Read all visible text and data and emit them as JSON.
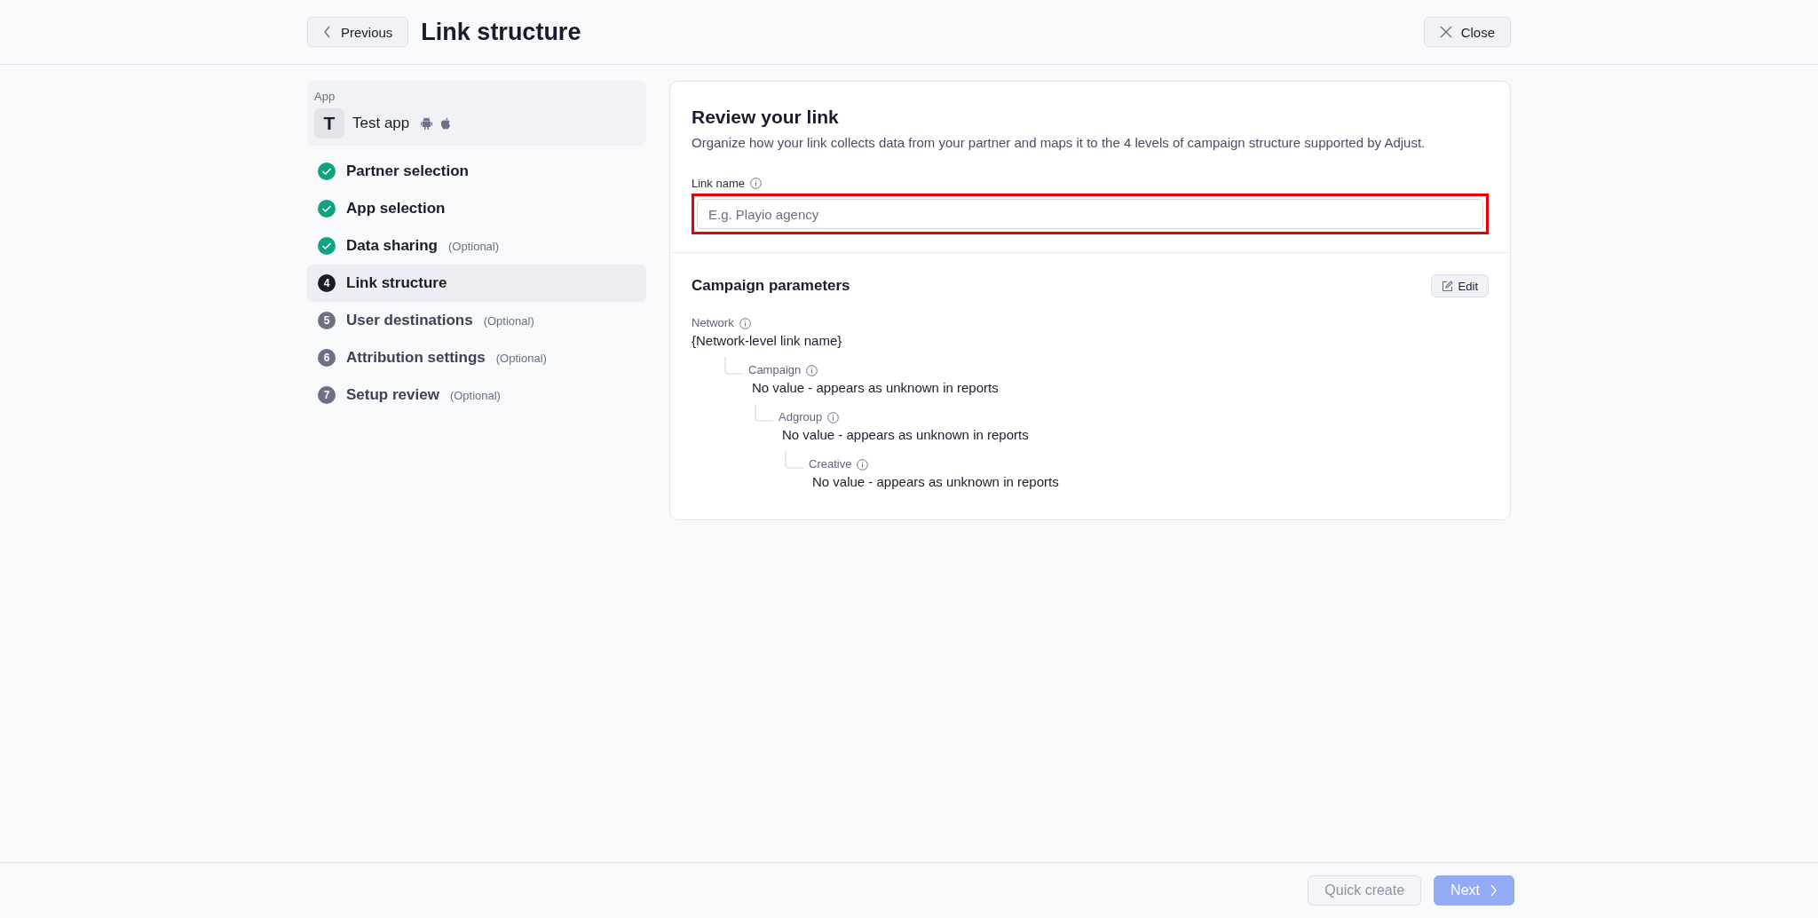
{
  "header": {
    "back_button": "Previous",
    "title": "Link structure",
    "close_button": "Close"
  },
  "sidebar": {
    "app": {
      "label": "App",
      "avatar": "T",
      "name": "Test app"
    },
    "steps": [
      {
        "label": "Partner selection",
        "kind": "done",
        "selected": false
      },
      {
        "label": "App selection",
        "kind": "done",
        "selected": false
      },
      {
        "label": "Data sharing",
        "note": "(Optional)",
        "kind": "done",
        "selected": false
      },
      {
        "label": "Link structure",
        "number": "4",
        "kind": "current",
        "selected": true
      },
      {
        "label": "User destinations",
        "note": "(Optional)",
        "number": "5",
        "kind": "pending",
        "selected": false
      },
      {
        "label": "Attribution settings",
        "note": "(Optional)",
        "number": "6",
        "kind": "pending",
        "selected": false
      },
      {
        "label": "Setup review",
        "note": "(Optional)",
        "number": "7",
        "kind": "pending",
        "selected": false
      }
    ]
  },
  "review": {
    "title": "Review your link",
    "description": "Organize how your link collects data from your partner and maps it to the 4 levels of campaign structure supported by Adjust.",
    "link_name": {
      "label": "Link name",
      "placeholder": "E.g. Playio agency",
      "highlighted": true
    }
  },
  "campaign_parameters": {
    "title": "Campaign parameters",
    "edit_button": "Edit",
    "tree": [
      {
        "label": "Network",
        "value": "{Network-level link name}",
        "children": [
          {
            "label": "Campaign",
            "value": "No value - appears as unknown in reports",
            "children": [
              {
                "label": "Adgroup",
                "value": "No value - appears as unknown in reports",
                "children": [
                  {
                    "label": "Creative",
                    "value": "No value - appears as unknown in reports"
                  }
                ]
              }
            ]
          }
        ]
      }
    ]
  },
  "footer": {
    "quick_create": {
      "label": "Quick create",
      "disabled": true
    },
    "next": {
      "label": "Next",
      "disabled": true
    }
  }
}
